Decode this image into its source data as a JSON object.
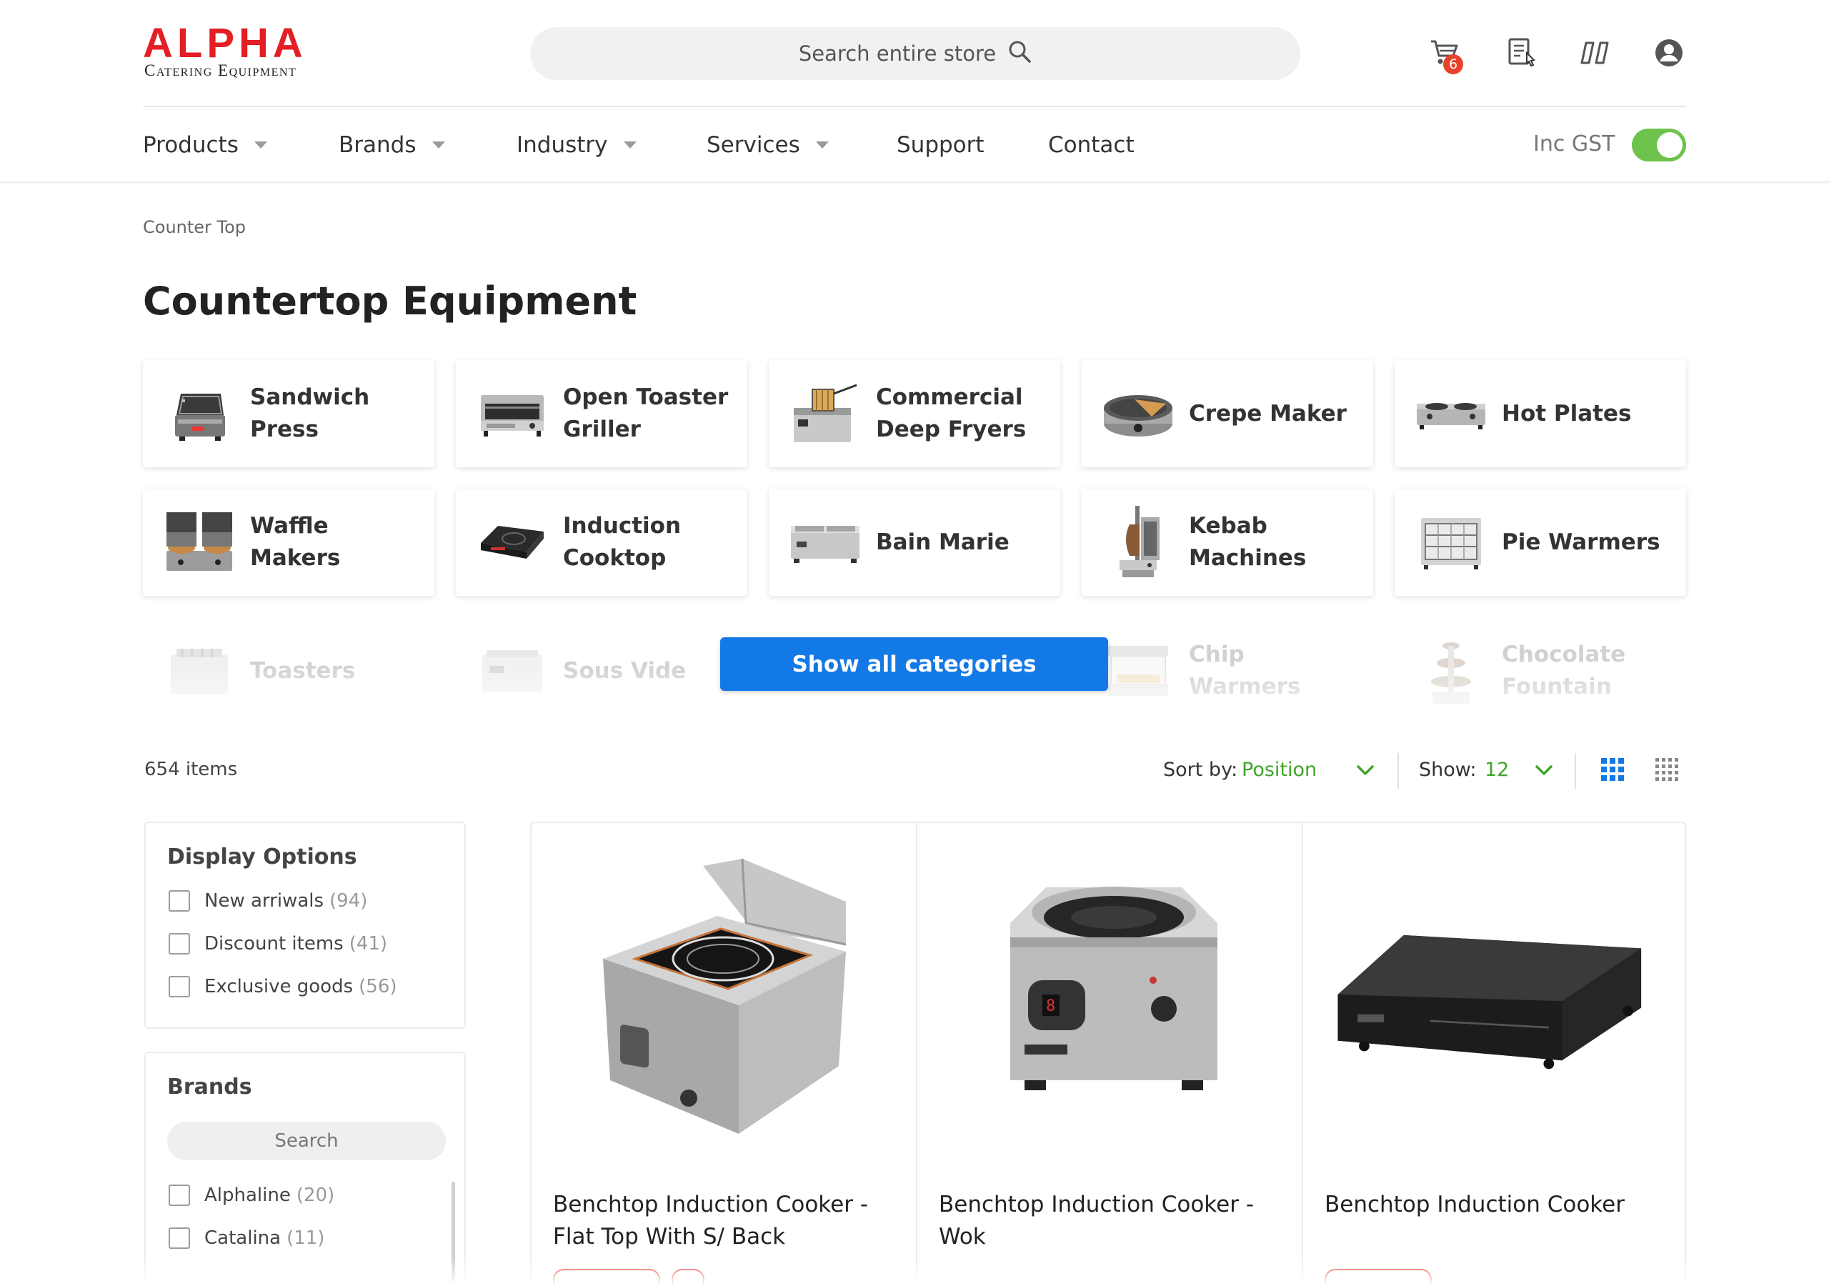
{
  "header": {
    "logo_word": "ALPHA",
    "logo_sub": "Catering Equipment",
    "search_placeholder": "Search entire store",
    "cart_count": "6"
  },
  "nav": {
    "items": [
      {
        "label": "Products",
        "dropdown": true
      },
      {
        "label": "Brands",
        "dropdown": true
      },
      {
        "label": "Industry",
        "dropdown": true
      },
      {
        "label": "Services",
        "dropdown": true
      },
      {
        "label": "Support",
        "dropdown": false
      },
      {
        "label": "Contact",
        "dropdown": false
      }
    ],
    "gst_label": "Inc GST",
    "gst_on": true
  },
  "breadcrumb": "Counter Top",
  "page_title": "Countertop Equipment",
  "categories": [
    {
      "label": "Sandwich Press",
      "icon": "sandwich-press-icon"
    },
    {
      "label": "Open Toaster Griller",
      "icon": "toaster-griller-icon"
    },
    {
      "label": "Commercial Deep Fryers",
      "icon": "deep-fryer-icon"
    },
    {
      "label": "Crepe Maker",
      "icon": "crepe-maker-icon"
    },
    {
      "label": "Hot Plates",
      "icon": "hot-plate-icon"
    },
    {
      "label": "Waffle Makers",
      "icon": "waffle-maker-icon"
    },
    {
      "label": "Induction Cooktop",
      "icon": "induction-cooktop-icon"
    },
    {
      "label": "Bain Marie",
      "icon": "bain-marie-icon"
    },
    {
      "label": "Kebab Machines",
      "icon": "kebab-machine-icon"
    },
    {
      "label": "Pie Warmers",
      "icon": "pie-warmer-icon"
    },
    {
      "label": "Toasters",
      "icon": "toaster-icon"
    },
    {
      "label": "Sous Vide",
      "icon": "sous-vide-icon"
    },
    {
      "label": "",
      "icon": ""
    },
    {
      "label": "Chip Warmers",
      "icon": "chip-warmer-icon"
    },
    {
      "label": "Chocolate Fountain",
      "icon": "chocolate-fountain-icon"
    }
  ],
  "show_all_label": "Show all categories",
  "toolbar": {
    "items_count": "654 items",
    "sort_label": "Sort by:",
    "sort_value": "Position",
    "show_label": "Show:",
    "show_value": "12",
    "accent": "#41a52a"
  },
  "display_options": {
    "title": "Display Options",
    "options": [
      {
        "label": "New arriwals",
        "count": "(94)"
      },
      {
        "label": "Discount items",
        "count": "(41)"
      },
      {
        "label": "Exclusive goods",
        "count": "(56)"
      }
    ]
  },
  "brands": {
    "title": "Brands",
    "search_placeholder": "Search",
    "options": [
      {
        "label": "Alphaline",
        "count": "(20)"
      },
      {
        "label": "Catalina",
        "count": "(11)"
      }
    ]
  },
  "products": [
    {
      "name": "Benchtop Induction Cooker - Flat Top With S/ Back"
    },
    {
      "name": "Benchtop Induction Cooker - Wok"
    },
    {
      "name": "Benchtop Induction Cooker"
    }
  ],
  "colors": {
    "brand_red": "#e31e24",
    "primary_blue": "#1379e6",
    "toggle_green": "#6cc24a"
  }
}
